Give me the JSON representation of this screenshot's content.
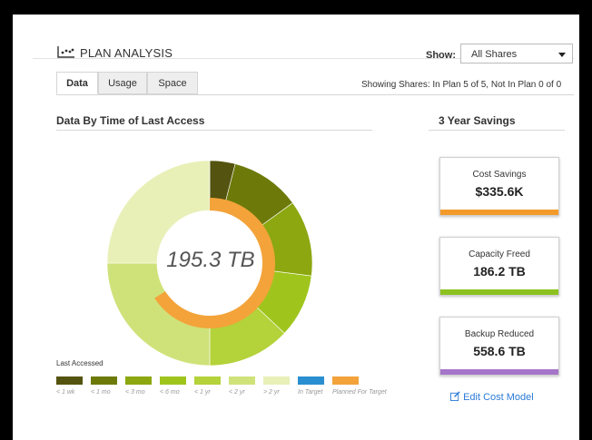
{
  "header": {
    "title": "PLAN ANALYSIS",
    "show_label": "Show:",
    "show_value": "All Shares"
  },
  "tabs": [
    {
      "label": "Data",
      "active": true
    },
    {
      "label": "Usage",
      "active": false
    },
    {
      "label": "Space",
      "active": false
    }
  ],
  "showing_text": "Showing Shares: In Plan 5 of 5, Not In Plan 0 of 0",
  "chart_section": {
    "title": "Data By Time of Last Access",
    "center_value": "195.3 TB"
  },
  "chart_data": {
    "type": "pie",
    "center_label": "195.3 TB",
    "outer_ring_fraction_of_total": [
      {
        "category": "< 1 wk",
        "fraction": 0.04
      },
      {
        "category": "< 1 mo",
        "fraction": 0.11
      },
      {
        "category": "< 3 mo",
        "fraction": 0.12
      },
      {
        "category": "< 6 mo",
        "fraction": 0.1
      },
      {
        "category": "< 1 yr",
        "fraction": 0.13
      },
      {
        "category": "< 2 yr",
        "fraction": 0.25
      },
      {
        "category": "> 2 yr",
        "fraction": 0.25
      }
    ],
    "inner_ring_fraction_of_total": [
      {
        "category": "Planned For Target",
        "fraction": 0.66
      }
    ],
    "legend_title": "Last Accessed",
    "legend": [
      {
        "label": "< 1 wk",
        "color": "#54530f"
      },
      {
        "label": "< 1 mo",
        "color": "#6d7a0a"
      },
      {
        "label": "< 3 mo",
        "color": "#8ca710"
      },
      {
        "label": "< 6 mo",
        "color": "#9fc51d"
      },
      {
        "label": "< 1 yr",
        "color": "#b4d23a"
      },
      {
        "label": "< 2 yr",
        "color": "#cfe27a"
      },
      {
        "label": "> 2 yr",
        "color": "#e8f0b8"
      },
      {
        "label": "In Target",
        "color": "#2a8fd0"
      },
      {
        "label": "Planned For Target",
        "color": "#f3a33a"
      }
    ]
  },
  "savings": {
    "title": "3 Year Savings",
    "cards": [
      {
        "title": "Cost Savings",
        "value": "$335.6K",
        "color": "#f39a2b"
      },
      {
        "title": "Capacity Freed",
        "value": "186.2 TB",
        "color": "#8cc11f"
      },
      {
        "title": "Backup Reduced",
        "value": "558.6 TB",
        "color": "#a575c9"
      }
    ],
    "edit_link": "Edit Cost Model"
  }
}
